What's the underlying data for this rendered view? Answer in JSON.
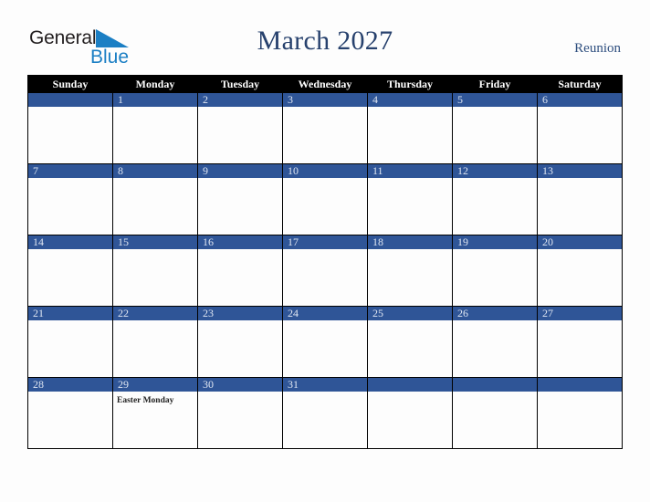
{
  "brand": {
    "name_part1": "General",
    "name_part2": "Blue",
    "triangle_icon": "blue-triangle-icon",
    "color_dark": "#231f20",
    "color_blue": "#1b7fc4"
  },
  "header": {
    "title": "March 2027",
    "region": "Reunion",
    "title_color": "#27416d",
    "region_color": "#2f4f7f"
  },
  "calendar": {
    "month": "March",
    "year": "2027",
    "accent_color": "#2f5597",
    "header_bg": "#000000",
    "header_text_color": "#ffffff",
    "weekdays": [
      "Sunday",
      "Monday",
      "Tuesday",
      "Wednesday",
      "Thursday",
      "Friday",
      "Saturday"
    ],
    "weeks": [
      [
        {
          "day": "",
          "events": []
        },
        {
          "day": "1",
          "events": []
        },
        {
          "day": "2",
          "events": []
        },
        {
          "day": "3",
          "events": []
        },
        {
          "day": "4",
          "events": []
        },
        {
          "day": "5",
          "events": []
        },
        {
          "day": "6",
          "events": []
        }
      ],
      [
        {
          "day": "7",
          "events": []
        },
        {
          "day": "8",
          "events": []
        },
        {
          "day": "9",
          "events": []
        },
        {
          "day": "10",
          "events": []
        },
        {
          "day": "11",
          "events": []
        },
        {
          "day": "12",
          "events": []
        },
        {
          "day": "13",
          "events": []
        }
      ],
      [
        {
          "day": "14",
          "events": []
        },
        {
          "day": "15",
          "events": []
        },
        {
          "day": "16",
          "events": []
        },
        {
          "day": "17",
          "events": []
        },
        {
          "day": "18",
          "events": []
        },
        {
          "day": "19",
          "events": []
        },
        {
          "day": "20",
          "events": []
        }
      ],
      [
        {
          "day": "21",
          "events": []
        },
        {
          "day": "22",
          "events": []
        },
        {
          "day": "23",
          "events": []
        },
        {
          "day": "24",
          "events": []
        },
        {
          "day": "25",
          "events": []
        },
        {
          "day": "26",
          "events": []
        },
        {
          "day": "27",
          "events": []
        }
      ],
      [
        {
          "day": "28",
          "events": []
        },
        {
          "day": "29",
          "events": [
            "Easter Monday"
          ]
        },
        {
          "day": "30",
          "events": []
        },
        {
          "day": "31",
          "events": []
        },
        {
          "day": "",
          "events": []
        },
        {
          "day": "",
          "events": []
        },
        {
          "day": "",
          "events": []
        }
      ]
    ]
  }
}
